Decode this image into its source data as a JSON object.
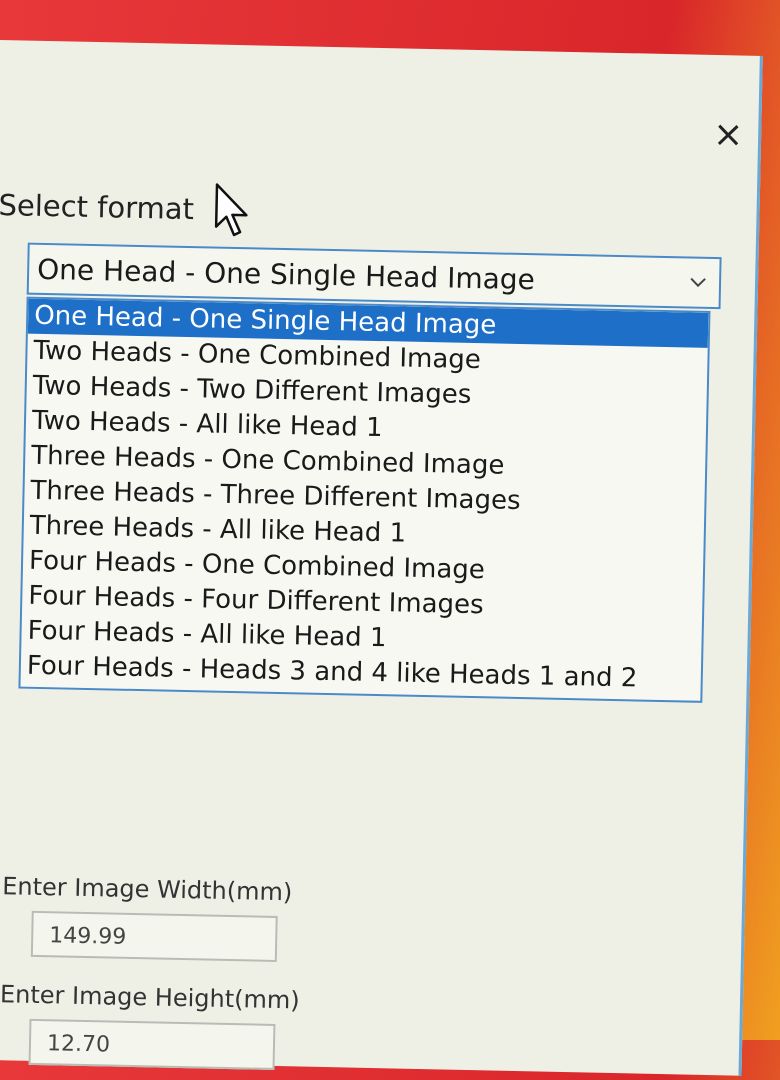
{
  "dialog": {
    "close_label": "×"
  },
  "format": {
    "label": "Select format",
    "selected_value": "One Head - One Single Head Image",
    "options": [
      "One Head - One Single Head Image",
      "Two Heads - One Combined Image",
      "Two Heads - Two Different Images",
      "Two Heads - All like Head 1",
      "Three Heads - One Combined Image",
      "Three Heads - Three Different Images",
      "Three Heads - All like Head 1",
      "Four Heads - One Combined Image",
      "Four Heads - Four Different Images",
      "Four Heads - All like Head 1",
      "Four Heads - Heads 3 and 4 like Heads 1 and 2"
    ]
  },
  "image_width": {
    "label": "Enter Image Width(mm)",
    "value": "149.99"
  },
  "image_height": {
    "label": "Enter Image Height(mm)",
    "value": "12.70"
  },
  "icons": {
    "close": "close-icon",
    "chevron": "chevron-down-icon",
    "cursor": "mouse-cursor-icon"
  },
  "colors": {
    "selection": "#1e6fc8",
    "border_accent": "#4a8ac8",
    "dialog_background": "#eef0e6"
  }
}
